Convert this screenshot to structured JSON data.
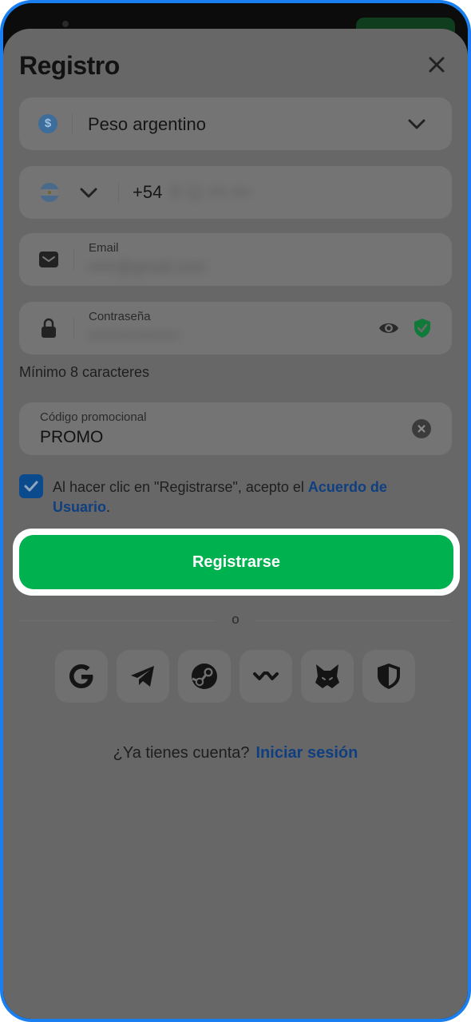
{
  "sheet": {
    "title": "Registro"
  },
  "currency": {
    "symbol": "$",
    "label": "Peso argentino"
  },
  "phone": {
    "prefix": "+54",
    "number": "9 11 ••• •••"
  },
  "email": {
    "label": "Email",
    "value": "•••••@gmail.com"
  },
  "password": {
    "label": "Contraseña",
    "value": "•••••••••••••",
    "hint": "Mínimo 8 caracteres"
  },
  "promo": {
    "label": "Código promocional",
    "value": "PROMO"
  },
  "agreement": {
    "checked": true,
    "text": "Al hacer clic en \"Registrarse\", acepto el ",
    "link": "Acuerdo de Usuario",
    "suffix": "."
  },
  "register_button": "Registrarse",
  "divider": "o",
  "social": [
    "google-icon",
    "telegram-icon",
    "steam-icon",
    "walletconnect-icon",
    "metamask-icon",
    "shield-icon"
  ],
  "login": {
    "question": "¿Ya tienes cuenta?",
    "link": "Iniciar sesión"
  },
  "colors": {
    "accent_green": "#00b14f",
    "link_blue": "#0f3f80",
    "frame_blue": "#1a7ff0",
    "overlay": "#676767"
  }
}
